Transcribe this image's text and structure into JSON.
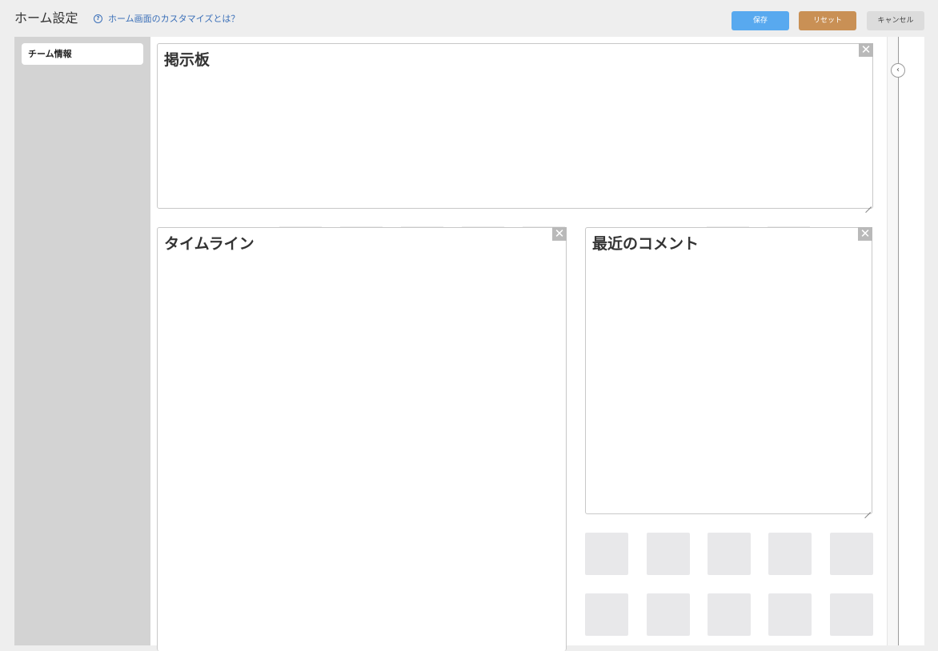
{
  "header": {
    "title": "ホーム設定",
    "help_icon": "question-circle-icon",
    "help_link": "ホーム画面のカスタマイズとは？",
    "help_glyph": "?",
    "buttons": {
      "save": "保存",
      "reset": "リセット",
      "cancel": "キャンセル"
    }
  },
  "colors": {
    "save": "#58a9ef",
    "reset": "#c99055",
    "cancel": "#dcdcdc",
    "link": "#3a6fb8"
  },
  "sidebar": {
    "items": [
      {
        "label": "チーム情報"
      }
    ]
  },
  "widgets": {
    "board": {
      "title": "掲示板",
      "close": "✕"
    },
    "timeline": {
      "title": "タイムライン",
      "close": "✕"
    },
    "comments": {
      "title": "最近のコメント",
      "close": "✕"
    }
  },
  "panel_toggle": {
    "icon": "chevron-left-icon",
    "glyph": "‹"
  }
}
